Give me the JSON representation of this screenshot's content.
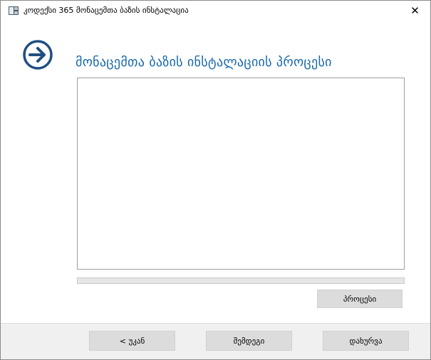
{
  "window": {
    "title": "კოდექსი 365 მონაცემთა ბაზის ინსტალაცია",
    "close_label": "✕"
  },
  "icons": {
    "app": "installer-app-icon",
    "header": "arrow-right-circle-icon",
    "close": "close-icon"
  },
  "colors": {
    "accent": "#1768ad",
    "icon": "#1f4e82",
    "button": "#dcdcdc",
    "footer": "#f0f0f0"
  },
  "main": {
    "title": "მონაცემთა ბაზის ინსტალაციის პროცესი",
    "log_text": "",
    "progress": 0,
    "process_button": "პროცესი"
  },
  "footer": {
    "back_button": "< უკან",
    "next_button": "შემდეგი",
    "close_button": "დახურვა"
  }
}
